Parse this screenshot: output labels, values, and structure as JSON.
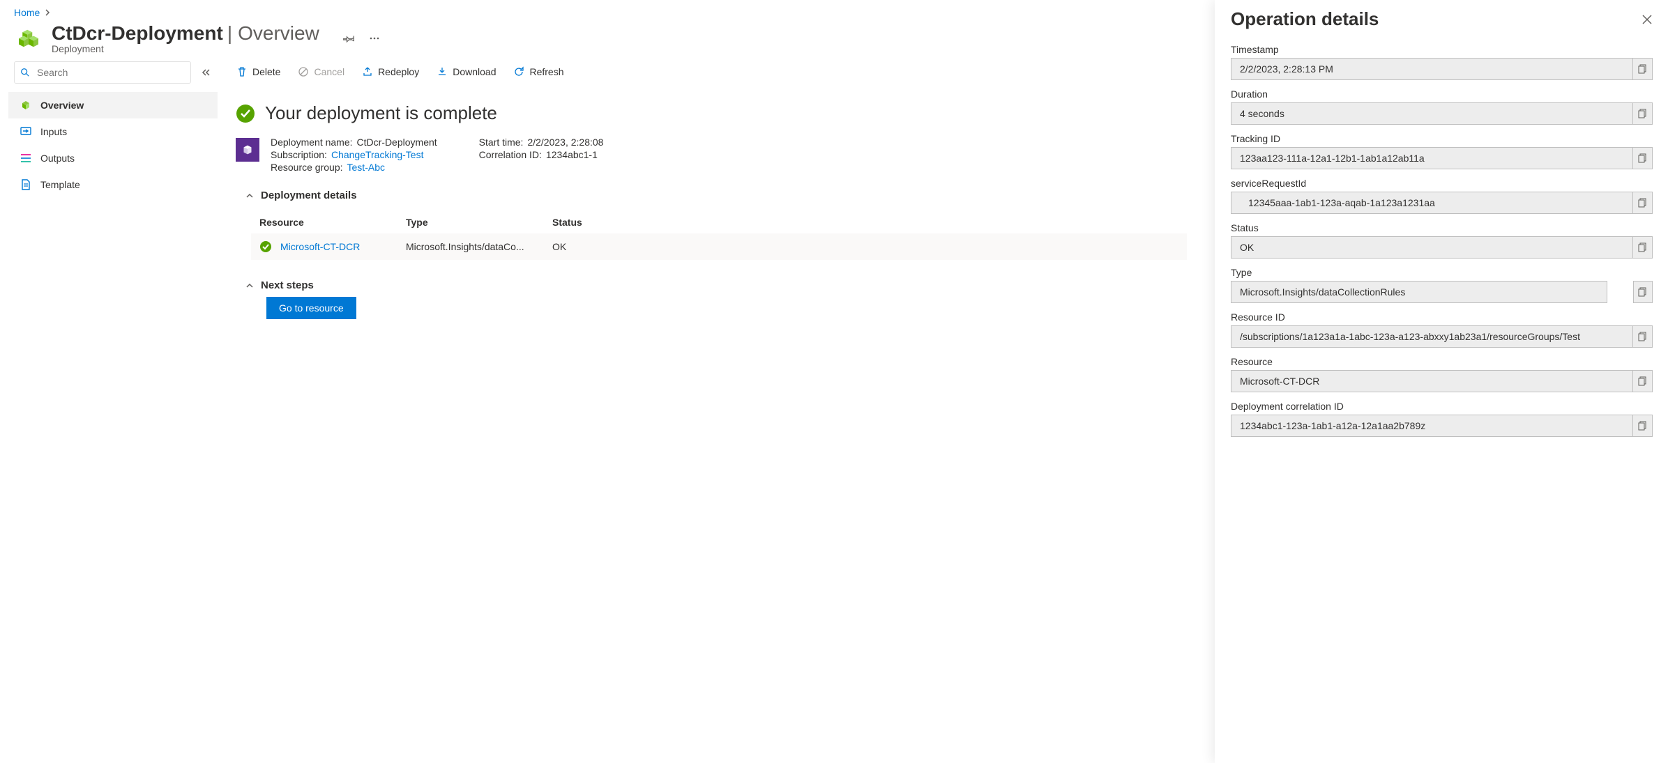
{
  "breadcrumb": {
    "home": "Home"
  },
  "header": {
    "name": "CtDcr-Deployment",
    "view": "Overview",
    "subtitle": "Deployment"
  },
  "search": {
    "placeholder": "Search"
  },
  "nav": {
    "overview": "Overview",
    "inputs": "Inputs",
    "outputs": "Outputs",
    "template": "Template"
  },
  "toolbar": {
    "delete": "Delete",
    "cancel": "Cancel",
    "redeploy": "Redeploy",
    "download": "Download",
    "refresh": "Refresh"
  },
  "status_msg": "Your deployment is complete",
  "info": {
    "deployment_name_k": "Deployment name:",
    "deployment_name_v": "CtDcr-Deployment",
    "subscription_k": "Subscription:",
    "subscription_v": "ChangeTracking-Test",
    "resource_group_k": "Resource group:",
    "resource_group_v": "Test-Abc",
    "start_time_k": "Start time:",
    "start_time_v": "2/2/2023, 2:28:08",
    "correlation_k": "Correlation ID:",
    "correlation_v": "1234abc1-1"
  },
  "sections": {
    "deployment_details": "Deployment details",
    "next_steps": "Next steps"
  },
  "table": {
    "cols": {
      "resource": "Resource",
      "type": "Type",
      "status": "Status"
    },
    "row": {
      "resource": "Microsoft-CT-DCR",
      "type": "Microsoft.Insights/dataCo...",
      "status": "OK"
    }
  },
  "go_to_resource": "Go to resource",
  "panel": {
    "title": "Operation details",
    "fields": {
      "timestamp_l": "Timestamp",
      "timestamp_v": "2/2/2023, 2:28:13 PM",
      "duration_l": "Duration",
      "duration_v": "4 seconds",
      "tracking_l": "Tracking ID",
      "tracking_v": "123aa123-111a-12a1-12b1-1ab1a12ab11a",
      "srid_l": "serviceRequestId",
      "srid_v": "12345aaa-1ab1-123a-aqab-1a123a1231aa",
      "status_l": "Status",
      "status_v": "OK",
      "type_l": "Type",
      "type_v": "Microsoft.Insights/dataCollectionRules",
      "resid_l": "Resource ID",
      "resid_v": "/subscriptions/1a123a1a-1abc-123a-a123-abxxy1ab23a1/resourceGroups/Test",
      "res_l": "Resource",
      "res_v": "Microsoft-CT-DCR",
      "dcid_l": "Deployment correlation ID",
      "dcid_v": "1234abc1-123a-1ab1-a12a-12a1aa2b789z"
    }
  }
}
